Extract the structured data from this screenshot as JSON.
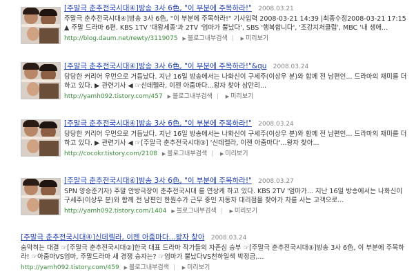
{
  "results": [
    {
      "title": "[주말극 춘추전국시대④]방송 3사 6色, \"이 부분에 주목하라!\"",
      "date": "2008.03.21",
      "snippet": "주말극 춘추전국시대④]방송 3사 6色, \"이 부분에 주목하라!\" 기사입력 2008-03-21 14:39 |최종수정2008-03-21 17:15 ▲ 주말 드라마 6편. KBS 1TV '대왕세종'과 2TV '엄마가 뿔났다', SBS '행복합니다', '조강지처클럽', MBC '내 생애...",
      "url": "http://blog.daum.net/rewty/3119075",
      "blog_search": "블로그내부검색",
      "preview": "미리보기"
    },
    {
      "title": "[주말극 춘추전국시대④]방송 3사 6色, \"이 부분에 주목하라!\"&qu",
      "date": "2008.03.24",
      "snippet": "당당한 커리어 우먼으로 거듭났다. 지난 16일 방송에서는 나화신이 구세주(이상우 분)와 함께 전 남편인... 드라마의 재미를 더하고 있다. ▶ 관련기사 ◀ ☞신데렐라, 이젠 아줌마다...왕자 찾아 삼만리...",
      "url": "http://yamh092.tistory.com/457",
      "blog_search": "블로그내부검색",
      "preview": "미리보기"
    },
    {
      "title": "[주말극 춘추전국시대④]방송 3사 6色, \"이 부분에 주목하라!\"",
      "date": "2008.03.24",
      "snippet": "당당한 커리어 우먼으로 거듭났다. 지난 16일 방송에서는 나화신이 구세주(이상우 분)와 함께 전 남편인... 드라마의 재미를 더하고 있다. ▶ 관련기사 ◀ ☞[주말극 춘추전국시대③] '신데렐라, 이젠 아줌마다'...왕자 찾아...",
      "url": "http://cocokr.tistory.com/2108",
      "blog_search": "블로그내부검색",
      "preview": "미리보기"
    },
    {
      "title": "[주말극 춘추전국시대④]방송 3사 6色, \"이 부분에 주목하라!\"",
      "date": "2008.03.27",
      "snippet": "SPN 양승준기자) 주말 안방극장이 춘추전국시대 를 연상케 하고 있다. KBS 2TV '엄마가... 지난 16일 방송에서는 나화신이 구세주(이상우 분)와 함께 전 남편인 한원수가 근무 중인 자동차 대리점을 찾아가 차를 사는 고객으로...",
      "url": "http://yamh092.tistory.com/1404",
      "blog_search": "블로그내부검색",
      "preview": "미리보기"
    },
    {
      "title": "[주말극 춘추전국시대④]신데렐라, 이젠 아줌마다...왕자 찾아",
      "date": "2008.03.24",
      "snippet": "숨막히는 대결 ☞[주말극 춘추전국시대②]한국 대표 드라마 작가들의 자존심 승부 ☞[주말극 춘추전국시대④]방송 3사 6色, 이 부분에 주목하라! ☞아줌마VS엄마, 주말드라마 새 경쟁 승자는? ☞엄마가 뿔났다VS천하일색 박정금,...",
      "url": "http://yamh092.tistory.com/459",
      "blog_search": "블로그내부검색",
      "preview": "미리보기"
    }
  ]
}
